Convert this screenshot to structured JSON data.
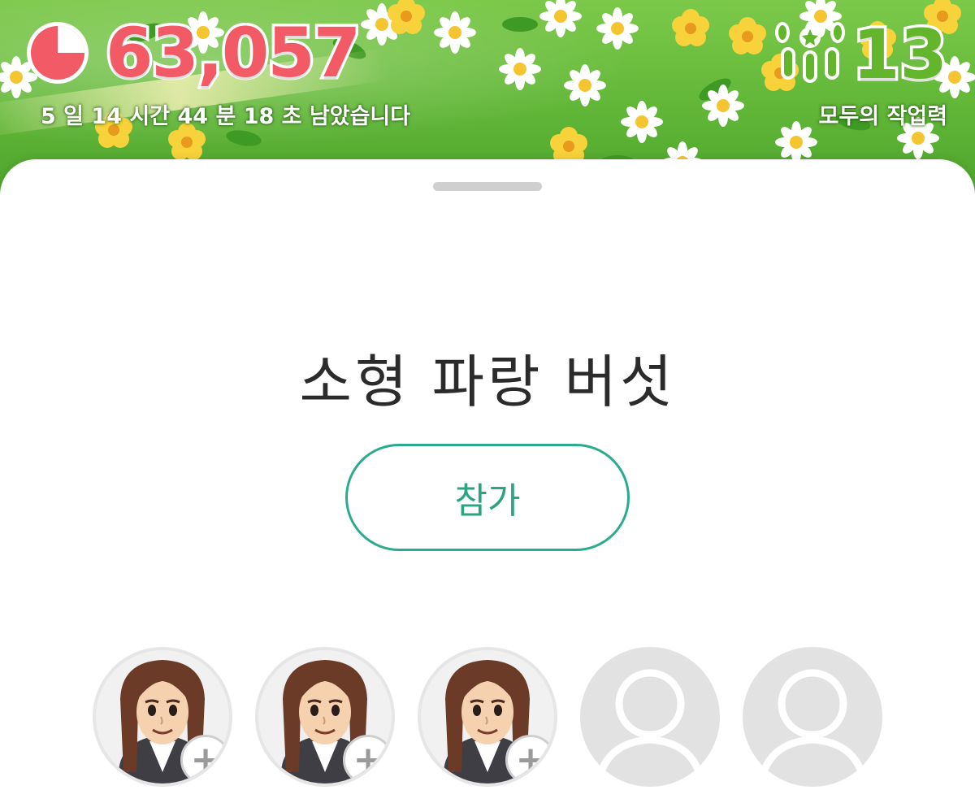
{
  "event": {
    "remaining_count": "63,057",
    "time_remaining": "5 일 14 시간 44 분 18 초 남았습니다",
    "work_count": "13",
    "work_label": "모두의 작업력"
  },
  "sheet": {
    "title": "소형 파랑 버섯",
    "join_label": "참가"
  },
  "slots": [
    {
      "state": "member",
      "add_label": "+"
    },
    {
      "state": "member",
      "add_label": "+"
    },
    {
      "state": "member",
      "add_label": "+"
    },
    {
      "state": "empty"
    },
    {
      "state": "empty"
    }
  ],
  "colors": {
    "count_red": "#f25b66",
    "work_green": "#63b52c",
    "accent_teal": "#2aab8d"
  },
  "icons": {
    "timer": "pie-timer-icon",
    "work": "pikmin-trio-icon",
    "member": "mii-avatar-icon",
    "empty": "person-silhouette-icon"
  }
}
